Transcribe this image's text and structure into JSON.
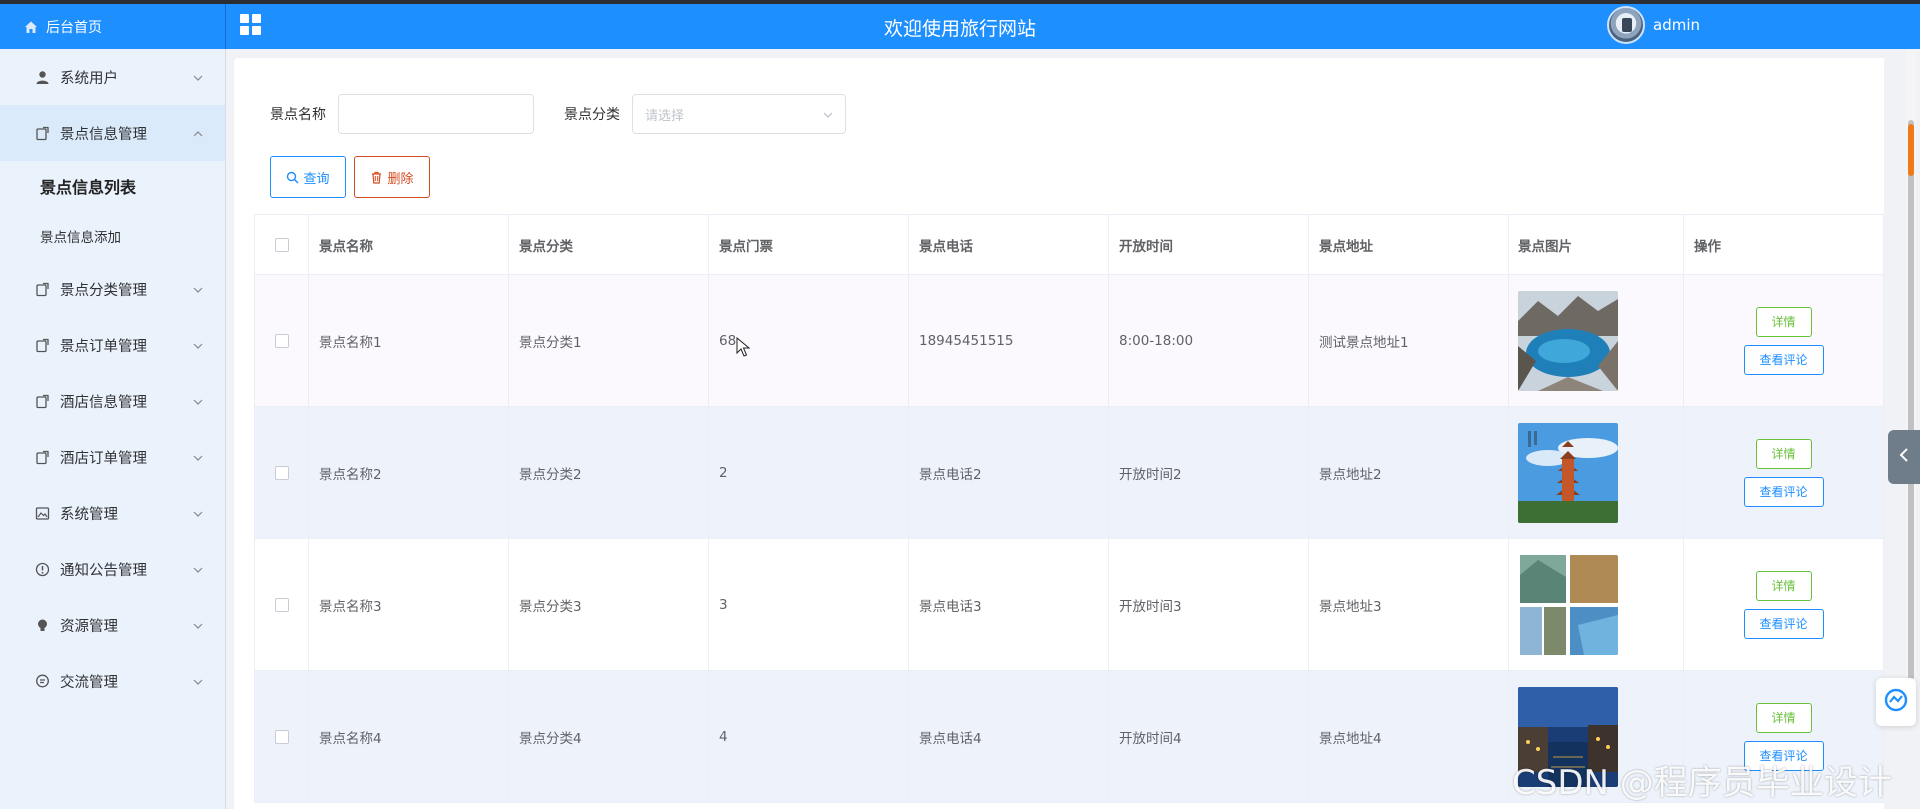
{
  "header": {
    "home_label": "后台首页",
    "site_title": "欢迎使用旅行网站",
    "user_name": "admin"
  },
  "sidebar": {
    "items": [
      {
        "label": "系统用户",
        "icon": "user-icon",
        "open": false
      },
      {
        "label": "景点信息管理",
        "icon": "doc-icon",
        "open": true,
        "children": [
          {
            "label": "景点信息列表",
            "active": true
          },
          {
            "label": "景点信息添加",
            "active": false
          }
        ]
      },
      {
        "label": "景点分类管理",
        "icon": "doc-icon",
        "open": false
      },
      {
        "label": "景点订单管理",
        "icon": "doc-icon",
        "open": false
      },
      {
        "label": "酒店信息管理",
        "icon": "doc-icon",
        "open": false
      },
      {
        "label": "酒店订单管理",
        "icon": "doc-icon",
        "open": false
      },
      {
        "label": "系统管理",
        "icon": "image-icon",
        "open": false
      },
      {
        "label": "通知公告管理",
        "icon": "info-icon",
        "open": false
      },
      {
        "label": "资源管理",
        "icon": "bulb-icon",
        "open": false
      },
      {
        "label": "交流管理",
        "icon": "chat-icon",
        "open": false
      }
    ]
  },
  "search": {
    "name_label": "景点名称",
    "name_value": "",
    "category_label": "景点分类",
    "category_placeholder": "请选择"
  },
  "buttons": {
    "query": "查询",
    "delete": "删除"
  },
  "table": {
    "columns": [
      "景点名称",
      "景点分类",
      "景点门票",
      "景点电话",
      "开放时间",
      "景点地址",
      "景点图片",
      "操作"
    ],
    "rows": [
      {
        "name": "景点名称1",
        "category": "景点分类1",
        "ticket": "68",
        "phone": "18945451515",
        "time": "8:00-18:00",
        "address": "测试景点地址1"
      },
      {
        "name": "景点名称2",
        "category": "景点分类2",
        "ticket": "2",
        "phone": "景点电话2",
        "time": "开放时间2",
        "address": "景点地址2"
      },
      {
        "name": "景点名称3",
        "category": "景点分类3",
        "ticket": "3",
        "phone": "景点电话3",
        "time": "开放时间3",
        "address": "景点地址3"
      },
      {
        "name": "景点名称4",
        "category": "景点分类4",
        "ticket": "4",
        "phone": "景点电话4",
        "time": "开放时间4",
        "address": "景点地址4"
      }
    ],
    "op_detail": "详情",
    "op_review": "查看评论"
  },
  "colors": {
    "primary": "#1e8fff",
    "danger": "#d64b20",
    "success": "#67c23a",
    "sidebar_bg": "#eaf3fc"
  },
  "watermark": "CSDN @程序员毕业设计"
}
